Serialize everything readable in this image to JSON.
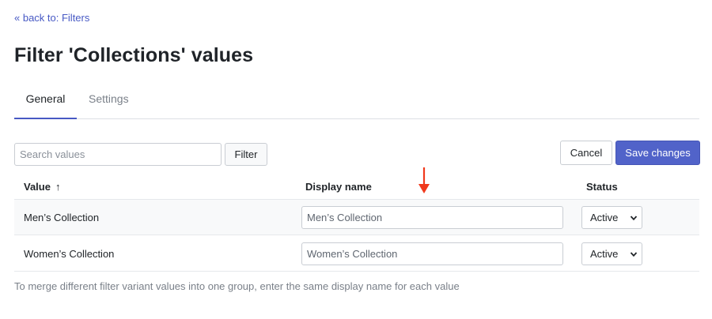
{
  "nav": {
    "back_link": "« back to: Filters"
  },
  "page": {
    "title": "Filter 'Collections' values"
  },
  "tabs": [
    {
      "label": "General",
      "active": true
    },
    {
      "label": "Settings",
      "active": false
    }
  ],
  "toolbar": {
    "search_placeholder": "Search values",
    "search_value": "",
    "filter_label": "Filter",
    "cancel_label": "Cancel",
    "save_label": "Save changes"
  },
  "table": {
    "headers": {
      "value": "Value",
      "value_sort_icon": "↑",
      "display_name": "Display name",
      "status": "Status"
    },
    "rows": [
      {
        "value": "Men’s Collection",
        "display_name": "Men’s Collection",
        "status": "Active"
      },
      {
        "value": "Women’s Collection",
        "display_name": "Women’s Collection",
        "status": "Active"
      }
    ]
  },
  "footer": {
    "note": "To merge different filter variant values into one group, enter the same display name for each value"
  },
  "colors": {
    "accent": "#5163c9",
    "link": "#4759c4",
    "annotation_arrow": "#f0391c"
  },
  "icons": {
    "sort": "arrow-up-icon",
    "select": "chevron-down-icon",
    "annotation": "down-arrow-annotation-icon"
  }
}
